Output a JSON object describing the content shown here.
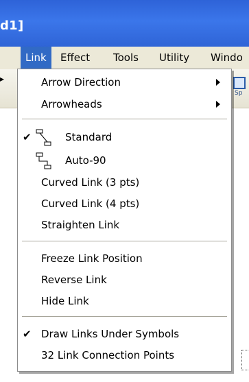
{
  "window": {
    "title_fragment": "d1]"
  },
  "menubar": {
    "items": [
      {
        "label": "Link",
        "active": true
      },
      {
        "label": "Effect"
      },
      {
        "label": "Tools"
      },
      {
        "label": "Utility"
      },
      {
        "label": "Windo"
      }
    ]
  },
  "toolbar": {
    "tiny_label": "Sp"
  },
  "link_menu": {
    "items": [
      {
        "label": "Arrow Direction",
        "submenu": true
      },
      {
        "label": "Arrowheads",
        "submenu": true
      },
      {
        "label": "Standard",
        "checked": true,
        "icon": "standard-link-icon"
      },
      {
        "label": "Auto-90",
        "checked": false,
        "icon": "auto-90-link-icon"
      },
      {
        "label": "Curved Link (3 pts)"
      },
      {
        "label": "Curved Link (4 pts)"
      },
      {
        "label": "Straighten Link"
      },
      {
        "label": "Freeze Link Position"
      },
      {
        "label": "Reverse Link"
      },
      {
        "label": "Hide Link"
      },
      {
        "label": "Draw Links Under Symbols",
        "checked": true
      },
      {
        "label": "32 Link Connection Points"
      }
    ],
    "check_glyph": "✔"
  },
  "colors": {
    "titlebar": "#3b76ea",
    "menu_highlight": "#316ac5",
    "menubar_bg": "#ece9d8"
  }
}
